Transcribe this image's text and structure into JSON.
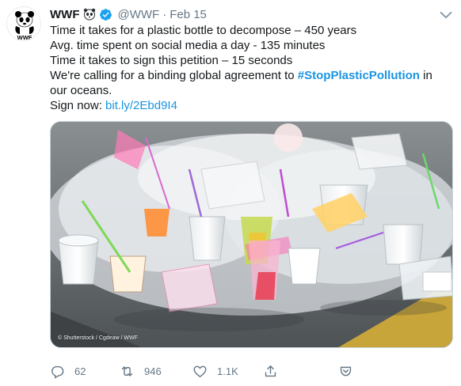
{
  "tweet": {
    "name": "WWF",
    "handle": "@WWF",
    "separator": "·",
    "date": "Feb 15",
    "avatar_logo_text": "WWF",
    "lines": {
      "l1": "Time it takes for a plastic bottle to decompose – 450 years",
      "l2": "Avg. time spent on social media a day - 135 minutes",
      "l3": "Time it takes to sign this petition – 15 seconds",
      "l4_pre": "We're calling for a binding global agreement to ",
      "l4_hashtag": "#StopPlasticPollution",
      "l4_post": " in",
      "l5": "our oceans.",
      "l6_pre": "Sign now: ",
      "l6_link": "bit.ly/2Ebd9I4"
    },
    "media_credit": "© Shutterstock / Cgdeaw / WWF"
  },
  "actions": {
    "reply_count": "62",
    "retweet_count": "946",
    "like_count": "1.1K"
  },
  "icons": {
    "verified": "verified-badge-icon",
    "panda": "panda-emoji-icon",
    "menu": "chevron-down-icon",
    "reply": "reply-icon",
    "retweet": "retweet-icon",
    "like": "heart-icon",
    "share": "share-icon",
    "bookmark": "bookmark-icon"
  },
  "colors": {
    "accent": "#1b95e0",
    "muted": "#657786",
    "text": "#14171a"
  }
}
